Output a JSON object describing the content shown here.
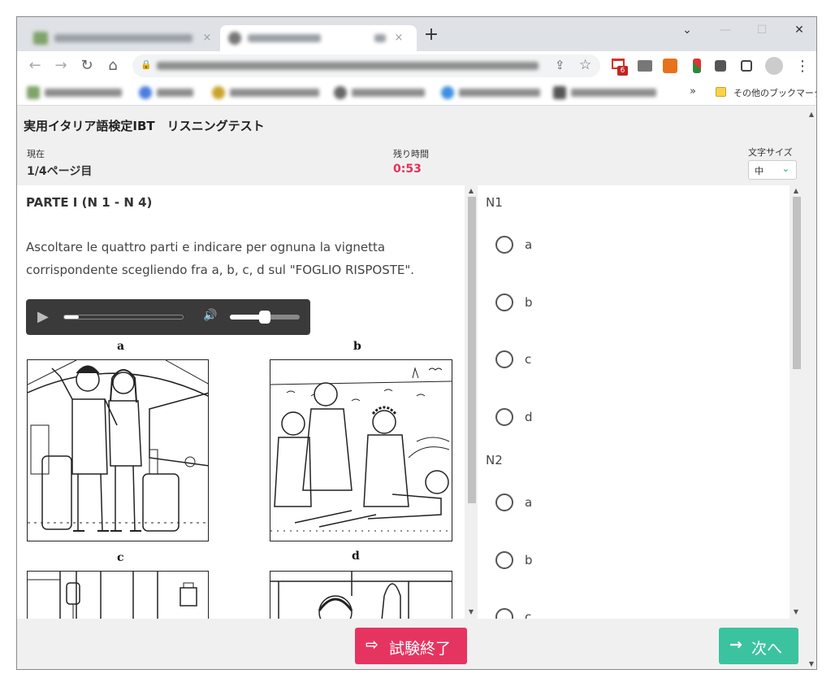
{
  "browser": {
    "new_tab_symbol": "+",
    "tab_close_symbol": "×",
    "window_controls": {
      "dropdown": "⌄",
      "minimize": "—",
      "maximize": "☐",
      "close": "✕"
    },
    "nav": {
      "back": "←",
      "forward": "→",
      "reload": "↻",
      "home": "⌂"
    },
    "lock_symbol": "🔒",
    "share_symbol": "⇪",
    "star_symbol": "☆",
    "gmail_badge": "6",
    "more_symbol": "⋮",
    "bookmarks_overflow": "»",
    "other_bookmarks_label": "その他のブックマーク"
  },
  "app": {
    "title": "実用イタリア語検定IBT　リスニングテスト",
    "current_label": "現在",
    "current_value": "1/4ページ目",
    "remaining_label": "残り時間",
    "remaining_value": "0:53",
    "font_size_label": "文字サイズ",
    "font_size_value": "中",
    "font_size_chevron": "⌄"
  },
  "question": {
    "section_title": "PARTE I (N 1 - N 4)",
    "instruction": "Ascoltare le quattro parti e indicare per ognuna la vignetta corrispondente scegliendo fra a, b, c, d sul \"FOGLIO RISPOSTE\".",
    "audio": {
      "play_symbol": "▶",
      "volume_symbol": "🔊",
      "progress": 0.06,
      "volume": 0.5
    },
    "vignette_labels": {
      "a": "a",
      "b": "b",
      "c": "c",
      "d": "d"
    }
  },
  "answers": {
    "n1": {
      "label": "N1",
      "options": [
        "a",
        "b",
        "c",
        "d"
      ]
    },
    "n2": {
      "label": "N2",
      "options": [
        "a",
        "b",
        "c"
      ]
    }
  },
  "footer": {
    "end_label": "試験終了",
    "end_icon": "⇨",
    "next_label": "次へ",
    "next_icon": "→"
  },
  "colors": {
    "timer": "#e2325d",
    "end_button": "#e63461",
    "next_button": "#3bc39f",
    "font_size_accent": "#23b89c"
  }
}
